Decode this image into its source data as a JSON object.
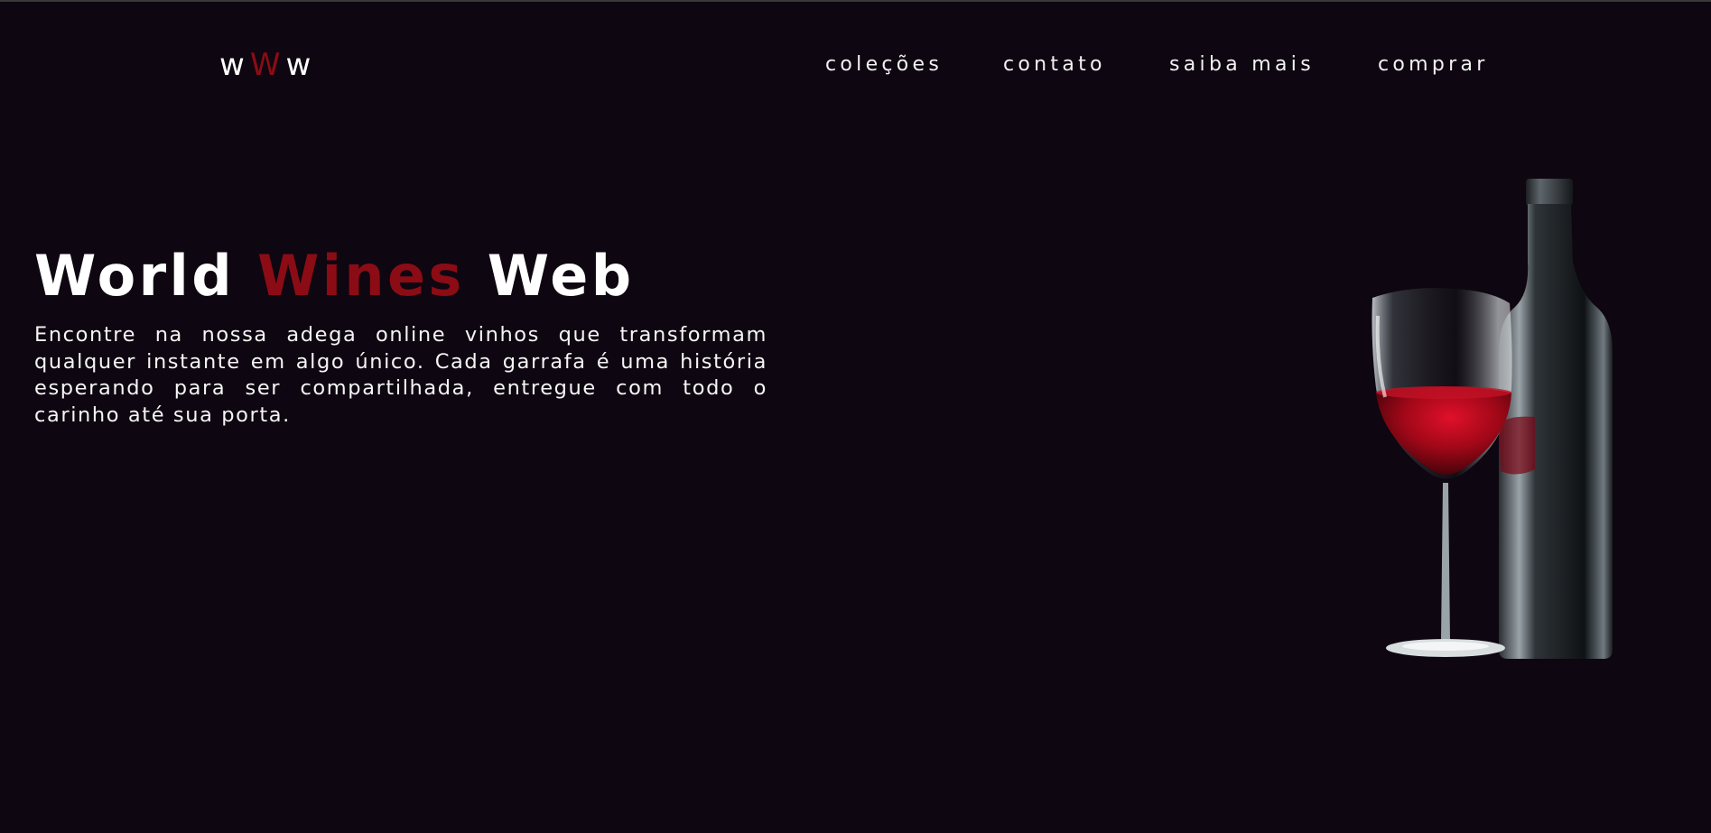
{
  "logo": {
    "letters": [
      "w",
      "W",
      "w"
    ],
    "accent_color": "#8b0c15"
  },
  "nav": {
    "items": [
      {
        "label": "coleções"
      },
      {
        "label": "contato"
      },
      {
        "label": "saiba mais"
      },
      {
        "label": "comprar"
      }
    ]
  },
  "hero": {
    "title_part1": "World",
    "title_part2": "Wines",
    "title_part3": "Web",
    "description": "Encontre na nossa adega online vinhos que transformam qualquer instante em algo único. Cada garrafa é uma história esperando para ser compartilhada, entregue com todo o carinho até sua porta."
  },
  "colors": {
    "background": "#0e0610",
    "accent": "#8b0c15",
    "text": "#ffffff"
  }
}
